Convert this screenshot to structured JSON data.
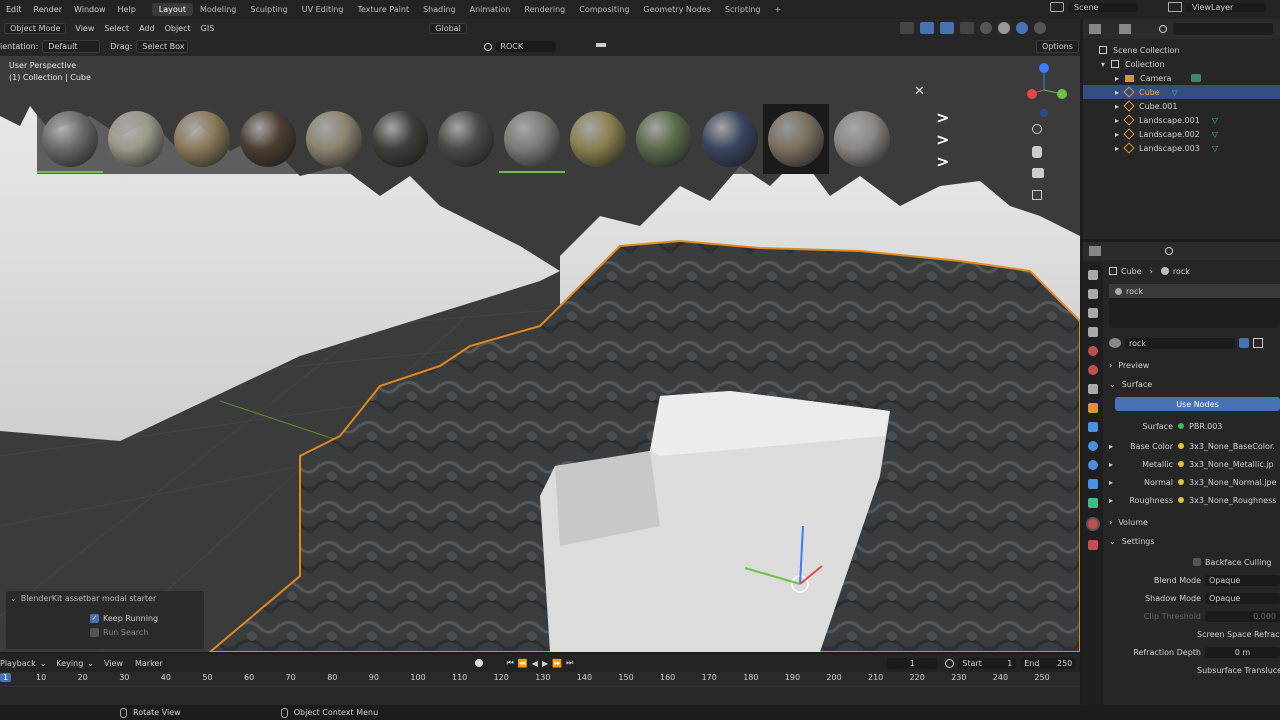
{
  "topbar": {
    "menus": [
      "Edit",
      "Render",
      "Window",
      "Help"
    ],
    "workspaces": [
      "Layout",
      "Modeling",
      "Sculpting",
      "UV Editing",
      "Texture Paint",
      "Shading",
      "Animation",
      "Rendering",
      "Compositing",
      "Geometry Nodes",
      "Scripting"
    ],
    "add_tab": "+",
    "scene": "Scene",
    "view_layer": "ViewLayer"
  },
  "viewport_header": {
    "mode": "Object Mode",
    "menus": [
      "View",
      "Select",
      "Add",
      "Object",
      "GIS"
    ],
    "orientation_label": "ientation:",
    "orientation_value": "Default",
    "drag_label": "Drag:",
    "drag_value": "Select Box",
    "transform": "Global",
    "search_text": "ROCK",
    "options": "Options"
  },
  "viewport": {
    "perspective": "User Perspective",
    "collection": "(1) Collection | Cube",
    "asset_bar_close": "✕",
    "asset_nav": [
      ">",
      ">",
      ">"
    ],
    "sphere_colors": [
      "#6a6a6a",
      "#9a9888",
      "#8a7a5a",
      "#4a3e32",
      "#8c8470",
      "#3e3e3a",
      "#4a4a48",
      "#7a7c78",
      "#8a8050",
      "#5a6a4a",
      "#3a4660",
      "#7a7060",
      "#8a8684"
    ],
    "modal": {
      "title": "BlenderKit assetbar modal starter",
      "keep_running": "Keep Running",
      "run_search": "Run Search"
    }
  },
  "outliner": {
    "root": "Scene Collection",
    "collection": "Collection",
    "items": [
      "Camera",
      "Cube",
      "Cube.001",
      "Landscape.001",
      "Landscape.002",
      "Landscape.003"
    ]
  },
  "properties": {
    "breadcrumb_object": "Cube",
    "breadcrumb_material": "rock",
    "slot": "rock",
    "material_name": "rock",
    "preview": "Preview",
    "surface_section": "Surface",
    "use_nodes": "Use Nodes",
    "surface_label": "Surface",
    "surface_value": "PBR.003",
    "inputs": [
      {
        "label": "Base Color",
        "value": "3x3_None_BaseColor."
      },
      {
        "label": "Metallic",
        "value": "3x3_None_Metallic.jp"
      },
      {
        "label": "Normal",
        "value": "3x3_None_Normal.jpe"
      },
      {
        "label": "Roughness",
        "value": "3x3_None_Roughness"
      }
    ],
    "volume": "Volume",
    "settings": "Settings",
    "backface_culling": "Backface Culling",
    "blend_mode_label": "Blend Mode",
    "blend_mode_value": "Opaque",
    "shadow_mode_label": "Shadow Mode",
    "shadow_mode_value": "Opaque",
    "clip_threshold_label": "Clip Threshold",
    "clip_threshold_value": "0.000",
    "screen_space": "Screen Space Refract",
    "refraction_depth_label": "Refraction Depth",
    "refraction_depth_value": "0 m",
    "subsurface": "Subsurface Transluce"
  },
  "timeline": {
    "menus": [
      "Playback",
      "Keying",
      "View",
      "Marker"
    ],
    "current_frame": "1",
    "start_label": "Start",
    "start_value": "1",
    "end_label": "End",
    "end_value": "250",
    "ticks": [
      "10",
      "20",
      "30",
      "40",
      "50",
      "60",
      "70",
      "80",
      "90",
      "100",
      "110",
      "120",
      "130",
      "140",
      "150",
      "160",
      "170",
      "180",
      "190",
      "200",
      "210",
      "220",
      "230",
      "240",
      "250"
    ],
    "playhead": "1"
  },
  "statusbar": {
    "rotate": "Rotate View",
    "context": "Object Context Menu"
  },
  "colors": {
    "accent": "#4772b3",
    "selection": "#ff8c00",
    "active_tab": "#3a3a3a"
  }
}
